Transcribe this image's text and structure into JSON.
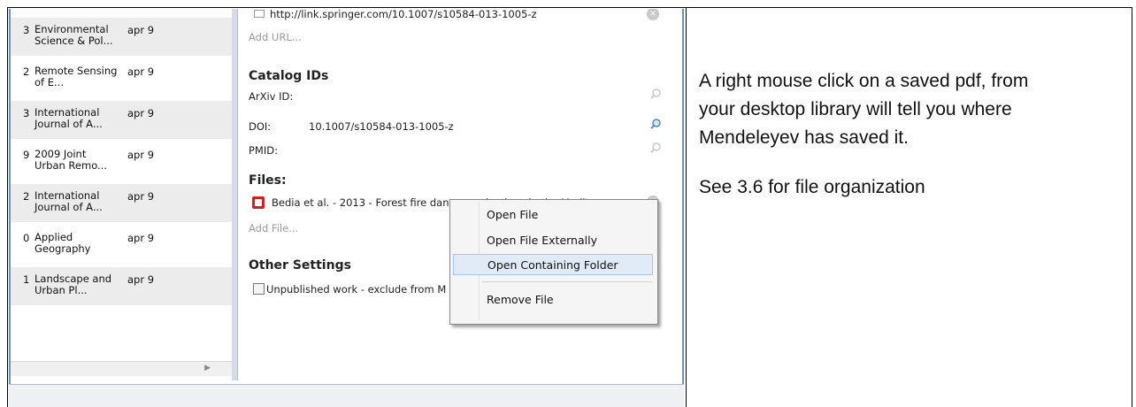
{
  "list": {
    "rows": [
      {
        "num": "3",
        "title": "Environmental Science & Pol...",
        "date": "apr 9"
      },
      {
        "num": "2",
        "title": "Remote Sensing of E...",
        "date": "apr 9"
      },
      {
        "num": "3",
        "title": "International Journal of A...",
        "date": "apr 9"
      },
      {
        "num": "9",
        "title": "2009 Joint Urban Remo...",
        "date": "apr 9"
      },
      {
        "num": "2",
        "title": "International Journal of A...",
        "date": "apr 9"
      },
      {
        "num": "0",
        "title": "Applied Geography",
        "date": "apr 9"
      },
      {
        "num": "1",
        "title": "Landscape and Urban Pl...",
        "date": "apr 9"
      }
    ]
  },
  "detail": {
    "url_value": "http://link.springer.com/10.1007/s10584-013-1005-z",
    "add_url": "Add URL...",
    "catalog_heading": "Catalog IDs",
    "arxiv_label": "ArXiv ID:",
    "doi_label": "DOI:",
    "doi_value": "10.1007/s10584-013-1005-z",
    "pmid_label": "PMID:",
    "files_heading": "Files:",
    "file_name": "Bedia et al. - 2013 - Forest fire danger projections in the Mediterr",
    "add_file": "Add File...",
    "other_heading": "Other Settings",
    "unpublished_label": "Unpublished work - exclude from M"
  },
  "context_menu": {
    "items": [
      "Open File",
      "Open File Externally",
      "Open Containing Folder",
      "Remove File"
    ]
  },
  "note": {
    "line1": "A right mouse click on a saved pdf, from",
    "line2": "your desktop library will tell you where",
    "line3": "Mendeleyev has saved it.",
    "line4": "See 3.6 for file organization"
  }
}
